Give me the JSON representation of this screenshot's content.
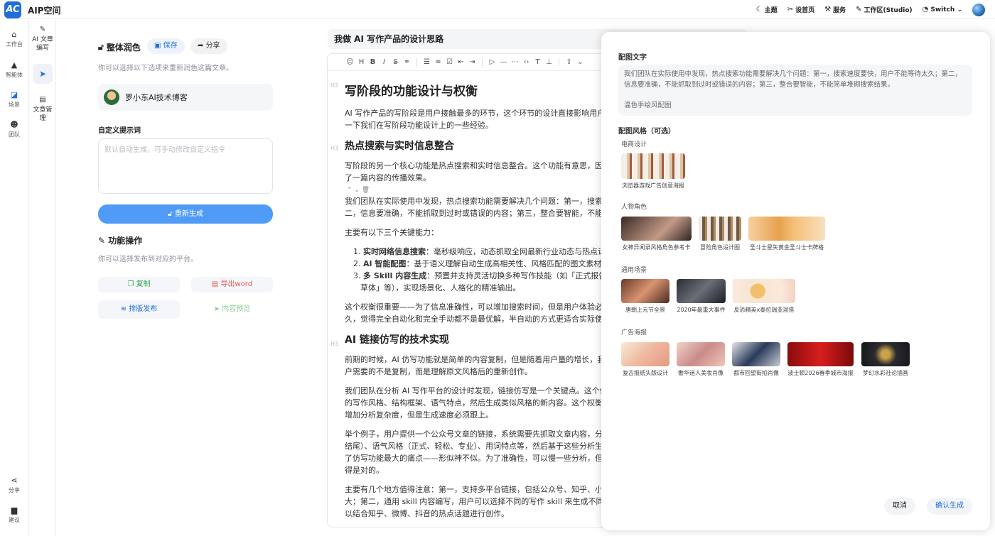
{
  "app": {
    "logo": "AC",
    "brand": "AIP空间"
  },
  "topnav": [
    {
      "icon": "☾",
      "label": "主题",
      "name": "nav-theme"
    },
    {
      "icon": "✂",
      "label": "设首页",
      "name": "nav-set-home"
    },
    {
      "icon": "⚒",
      "label": "服务",
      "name": "nav-service"
    },
    {
      "icon": "✎",
      "label": "工作区(Studio)",
      "name": "nav-workspace-studio"
    },
    {
      "icon": "◔",
      "label": "Switch ⌄",
      "name": "nav-switch"
    }
  ],
  "rail": {
    "workbench": "工作台",
    "agent": "智能体",
    "scene": "场景",
    "team": "团队",
    "share": "分享",
    "feedback": "建议"
  },
  "subnav": {
    "ai_write": "AI 文章编写",
    "doc_manage": "文章管理"
  },
  "left": {
    "title": "整体润色",
    "save": "保存",
    "share": "分享",
    "subtitle": "你可以选择以下选项来重新润色这篇文章。",
    "user": "罗小东AI技术博客",
    "prompt_label": "自定义提示词",
    "prompt_placeholder": "默认自动生成，可手动修改自定义指令",
    "regen": "重新生成",
    "ops_title": "功能操作",
    "ops_sub": "你可以选择发布到对应的平台。",
    "copy": "复制",
    "export": "导出word",
    "publish": "排版发布",
    "preview": "内容预览"
  },
  "doc": {
    "title": "我做 AI 写作产品的设计思路",
    "h2": "写阶段的功能设计与权衡",
    "p1a": "AI 写作产品的写阶段是用户接触最多的环节，这个环节的设计直接影响用户",
    "p1b": "一下我们在写阶段功能设计上的一些经验。",
    "h3a": "热点搜索与实时信息整合",
    "p2a": "写阶段的另一个核心功能是热点搜索和实时信息整合。这个功能有意思，因",
    "p2b": "了一篇内容的传播效果。",
    "ctl": "⌃  ⌄  🗑",
    "p3a": "我们团队在实际使用中发现，热点搜索功能需要解决几个问题：第一，搜索",
    "p3b": "二，信息要准确，不能抓取到过时或错误的内容；第三，整合要智能，不能",
    "p4": "主要有以下三个关键能力：",
    "li1b": "实时网络信息搜索",
    "li1": "：毫秒级响应，动态抓取全网最新行业动态与热点话",
    "li2b": "AI 智能配图",
    "li2": "：基于语义理解自动生成高相关性、风格匹配的图文素材，",
    "li3b": "多 Skill 内容生成",
    "li3": "：预置并支持灵活切换多种写作技能（如「正式报告」",
    "li3c": "草体」等），实现场景化、人格化的精准输出。",
    "p5a": "这个权衡很重要——为了信息准确性，可以增加搜索时间，但是用户体验必",
    "p5b": "久，觉得完全自动化和完全手动都不是最优解，半自动的方式更适合实际使",
    "h3b": "AI 链接仿写的技术实现",
    "p6a": "前期的时候，AI 仿写功能就是简单的内容复制，但是随着用户量的增长，我",
    "p6b": "户需要的不是复制，而是理解原文风格后的重新创作。",
    "p7a": "我们团队在分析 AI 写作平台的设计时发现，链接仿写是一个关键点。这个仿",
    "p7b": "的写作风格、结构框架、语气特点，然后生成类似风格的新内容。这个权衡",
    "p7c": "增加分析复杂度，但是生成速度必须跟上。",
    "p8a": "举个例子，用户提供一个公众号文章的链接，系统需要先抓取文章内容，分",
    "p8b": "结尾）、语气风格（正式、轻松、专业）、用词特点等，然后基于这些分析生",
    "p8c": "了仿写功能最大的痛点——形似神不似。为了准确性，可以慢一些分析，但",
    "p8d": "得是对的。",
    "p9a": "主要有几个地方值得注意：第一，支持多平台链接，包括公众号、知乎、小",
    "p9b": "大；第二，通用 skill 内容编写，用户可以选择不同的写作 skill 来生成不同风",
    "p9c": "以结合知乎、微博、抖音的热点话题进行创作。"
  },
  "drawer": {
    "label_text": "配图文字",
    "text1": "我们团队在实际使用中发现，热点搜索功能需要解决几个问题：第一，搜索速度要快，用户不能等待太久；第二，信息要准确，不能抓取到过时或错误的内容；第三，整合要智能，不能简单堆砌搜索结果。",
    "text2": "温色手绘风配图",
    "label_style": "配图风格（可选）",
    "cats": {
      "ecom": "电商设计",
      "char": "人物角色",
      "general": "通用场景",
      "ad": "广告海报"
    },
    "ecom": [
      "浏览器游戏广告创意海报"
    ],
    "char": [
      "女神异闻录风格角色参考卡",
      "冒险角色设计图",
      "圣斗士星矢黄金圣斗士卡牌格"
    ],
    "general": [
      "唐朝上元节全景",
      "2020年最重大事件",
      "反恐精英x泰拉瑞亚混搭"
    ],
    "ad": [
      "复古报纸头版设计",
      "奢华迷人美妆肖像",
      "都市回望街拍肖像",
      "波士顿2026春季城市海报",
      "梦幻水彩社论插画"
    ],
    "cancel": "取消",
    "confirm": "确认生成"
  }
}
